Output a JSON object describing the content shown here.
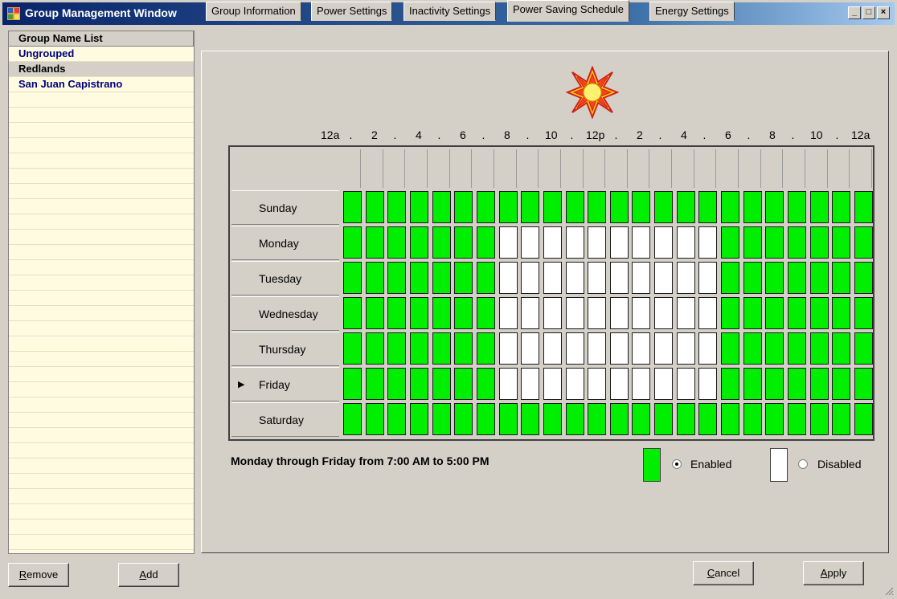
{
  "window": {
    "title": "Group Management Window",
    "controls": [
      "_",
      "□",
      "×"
    ]
  },
  "group_list": {
    "header": "Group Name List",
    "items": [
      {
        "label": "Ungrouped",
        "selected": false
      },
      {
        "label": "Redlands",
        "selected": true
      },
      {
        "label": "San Juan Capistrano",
        "selected": false
      }
    ]
  },
  "tabs": [
    "Group Information",
    "Power Settings",
    "Inactivity Settings",
    "Power Saving Schedule",
    "Energy Settings"
  ],
  "active_tab": "Power Saving Schedule",
  "schedule": {
    "hour_labels": [
      "12a",
      ".",
      "2",
      ".",
      "4",
      ".",
      "6",
      ".",
      "8",
      ".",
      "10",
      ".",
      "12p",
      ".",
      "2",
      ".",
      "4",
      ".",
      "6",
      ".",
      "8",
      ".",
      "10",
      ".",
      "12a"
    ],
    "days": [
      "Sunday",
      "Monday",
      "Tuesday",
      "Wednesday",
      "Thursday",
      "Friday",
      "Saturday"
    ],
    "current_day": "Friday",
    "row_states": {
      "Sunday": "111111111111111111111111",
      "Monday": "111111100000000001111111",
      "Tuesday": "111111100000000001111111",
      "Wednesday": "111111100000000001111111",
      "Thursday": "111111100000000001111111",
      "Friday": "111111100000000001111111",
      "Saturday": "111111111111111111111111"
    },
    "summary": "Monday through Friday from 7:00 AM to 5:00 PM",
    "legend": {
      "enabled_label": "Enabled",
      "disabled_label": "Disabled",
      "selected": "Enabled"
    },
    "colors": {
      "enabled": "#00ee00",
      "disabled": "#ffffff"
    }
  },
  "buttons": {
    "remove": {
      "mnemonic": "R",
      "rest": "emove"
    },
    "add": {
      "mnemonic": "A",
      "rest": "dd"
    },
    "cancel": {
      "mnemonic": "C",
      "rest": "ancel"
    },
    "apply": {
      "mnemonic": "A",
      "rest": "pply"
    }
  }
}
